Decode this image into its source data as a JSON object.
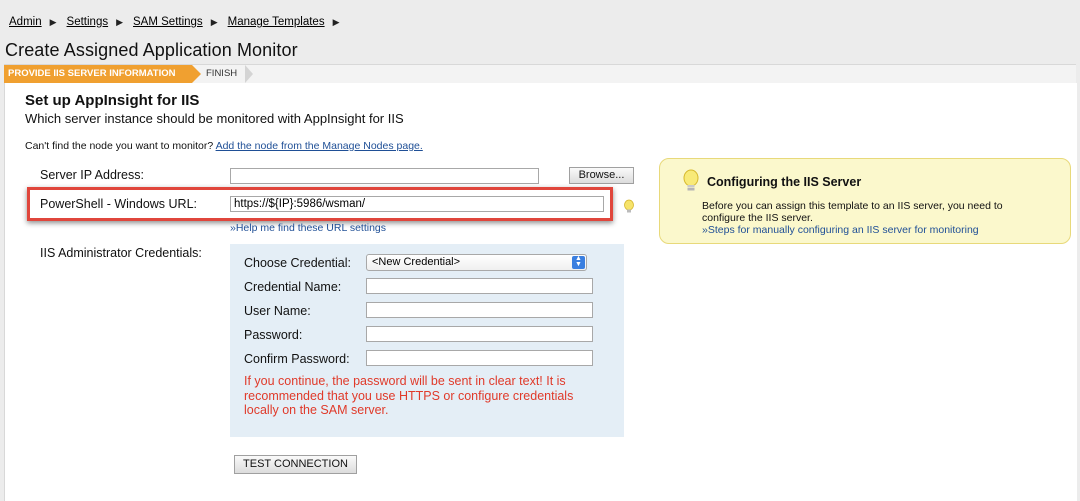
{
  "breadcrumb": {
    "items": [
      "Admin",
      "Settings",
      "SAM Settings",
      "Manage Templates"
    ],
    "separator": "▶"
  },
  "page_title": "Create Assigned Application Monitor",
  "wizard": {
    "active_step": "PROVIDE IIS SERVER INFORMATION",
    "next_step": "FINISH"
  },
  "section": {
    "title": "Set up AppInsight for IIS",
    "subtitle": "Which server instance should be monitored with AppInsight for IIS",
    "hint_text": "Can't find the node you want to monitor?",
    "hint_link": "Add the node from the Manage Nodes page."
  },
  "form": {
    "server_ip_label": "Server IP Address:",
    "server_ip_value": "",
    "browse_label": "Browse...",
    "powershell_label": "PowerShell - Windows URL:",
    "powershell_value": "https://${IP}:5986/wsman/",
    "help_link": "»Help me find these URL settings",
    "credentials_label": "IIS Administrator Credentials:"
  },
  "credentials": {
    "choose_label": "Choose Credential:",
    "choose_value": "<New Credential>",
    "name_label": "Credential Name:",
    "user_label": "User Name:",
    "password_label": "Password:",
    "confirm_label": "Confirm Password:",
    "warning": "If you continue, the password will be sent in clear text! It is recommended that you use HTTPS or configure credentials locally on the SAM server."
  },
  "test_button": "TEST CONNECTION",
  "info": {
    "title": "Configuring the IIS Server",
    "body": "Before you can assign this template to an IIS server, you need to configure the IIS server.",
    "link": "»Steps for manually configuring an IIS server for monitoring"
  },
  "colors": {
    "wizard_active": "#f0a030",
    "link": "#1f4f96",
    "warning": "#e03a2a",
    "highlight": "#e0463c",
    "info_bg": "#fbf8cc",
    "cred_bg": "#e4eef6"
  },
  "icons": [
    "lightbulb-icon",
    "chevron-right-icon",
    "dropdown-arrows-icon"
  ]
}
